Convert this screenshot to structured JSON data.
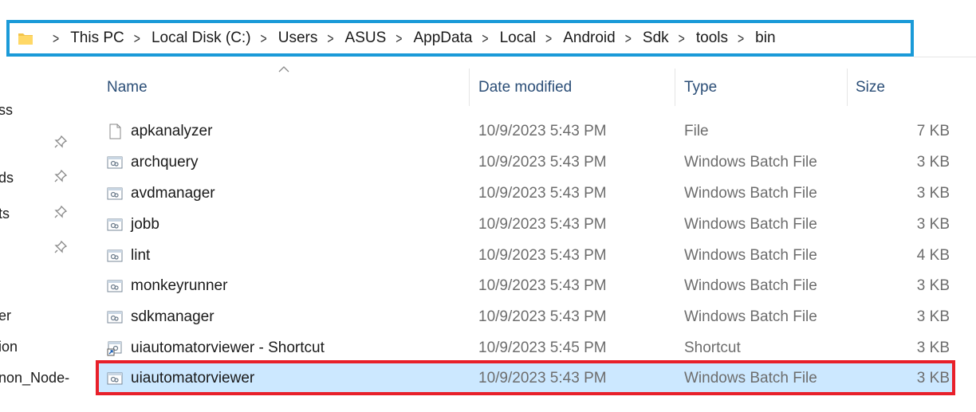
{
  "address_bar": {
    "crumbs": [
      "This PC",
      "Local Disk (C:)",
      "Users",
      "ASUS",
      "AppData",
      "Local",
      "Android",
      "Sdk",
      "tools",
      "bin"
    ]
  },
  "nav_pane": {
    "items": [
      "ss",
      "ds",
      "ts",
      "er",
      "ion",
      "non_Node-"
    ]
  },
  "columns": {
    "name": "Name",
    "date": "Date modified",
    "type": "Type",
    "size": "Size"
  },
  "files": [
    {
      "name": "apkanalyzer",
      "date": "10/9/2023 5:43 PM",
      "type": "File",
      "size": "7 KB",
      "icon": "blank-file-icon"
    },
    {
      "name": "archquery",
      "date": "10/9/2023 5:43 PM",
      "type": "Windows Batch File",
      "size": "3 KB",
      "icon": "batch-file-icon"
    },
    {
      "name": "avdmanager",
      "date": "10/9/2023 5:43 PM",
      "type": "Windows Batch File",
      "size": "3 KB",
      "icon": "batch-file-icon"
    },
    {
      "name": "jobb",
      "date": "10/9/2023 5:43 PM",
      "type": "Windows Batch File",
      "size": "3 KB",
      "icon": "batch-file-icon"
    },
    {
      "name": "lint",
      "date": "10/9/2023 5:43 PM",
      "type": "Windows Batch File",
      "size": "4 KB",
      "icon": "batch-file-icon"
    },
    {
      "name": "monkeyrunner",
      "date": "10/9/2023 5:43 PM",
      "type": "Windows Batch File",
      "size": "3 KB",
      "icon": "batch-file-icon"
    },
    {
      "name": "sdkmanager",
      "date": "10/9/2023 5:43 PM",
      "type": "Windows Batch File",
      "size": "3 KB",
      "icon": "batch-file-icon"
    },
    {
      "name": "uiautomatorviewer - Shortcut",
      "date": "10/9/2023 5:45 PM",
      "type": "Shortcut",
      "size": "3 KB",
      "icon": "shortcut-icon"
    },
    {
      "name": "uiautomatorviewer",
      "date": "10/9/2023 5:43 PM",
      "type": "Windows Batch File",
      "size": "3 KB",
      "icon": "batch-file-icon",
      "selected": true
    }
  ],
  "colors": {
    "address_highlight": "#1a9ad8",
    "selection_highlight": "#e8202a",
    "selected_row_bg": "#cce8ff",
    "header_text": "#2b4e77"
  }
}
